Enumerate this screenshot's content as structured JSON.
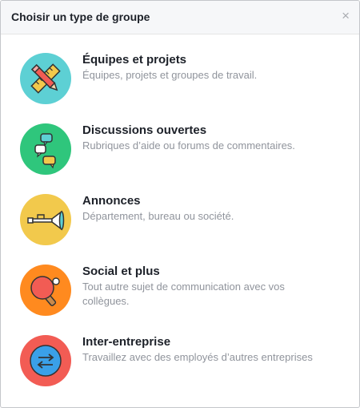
{
  "dialog": {
    "title": "Choisir un type de groupe",
    "close_label": "×"
  },
  "options": [
    {
      "title": "Équipes et projets",
      "desc": "Équipes, projets et groupes de travail.",
      "icon": "ruler-pencil-icon",
      "color": "#5dd0d4"
    },
    {
      "title": "Discussions ouvertes",
      "desc": "Rubriques d’aide ou forums de commentaires.",
      "icon": "chat-bubbles-icon",
      "color": "#2fc67c"
    },
    {
      "title": "Annonces",
      "desc": "Département, bureau ou société.",
      "icon": "trumpet-icon",
      "color": "#f2c94c"
    },
    {
      "title": "Social et plus",
      "desc": "Tout autre sujet de communication avec vos collègues.",
      "icon": "ping-pong-icon",
      "color": "#ff8a1f"
    },
    {
      "title": "Inter-entreprise",
      "desc": "Travaillez avec des employés d’autres entreprises",
      "icon": "exchange-arrows-icon",
      "color": "#f25c54"
    }
  ]
}
